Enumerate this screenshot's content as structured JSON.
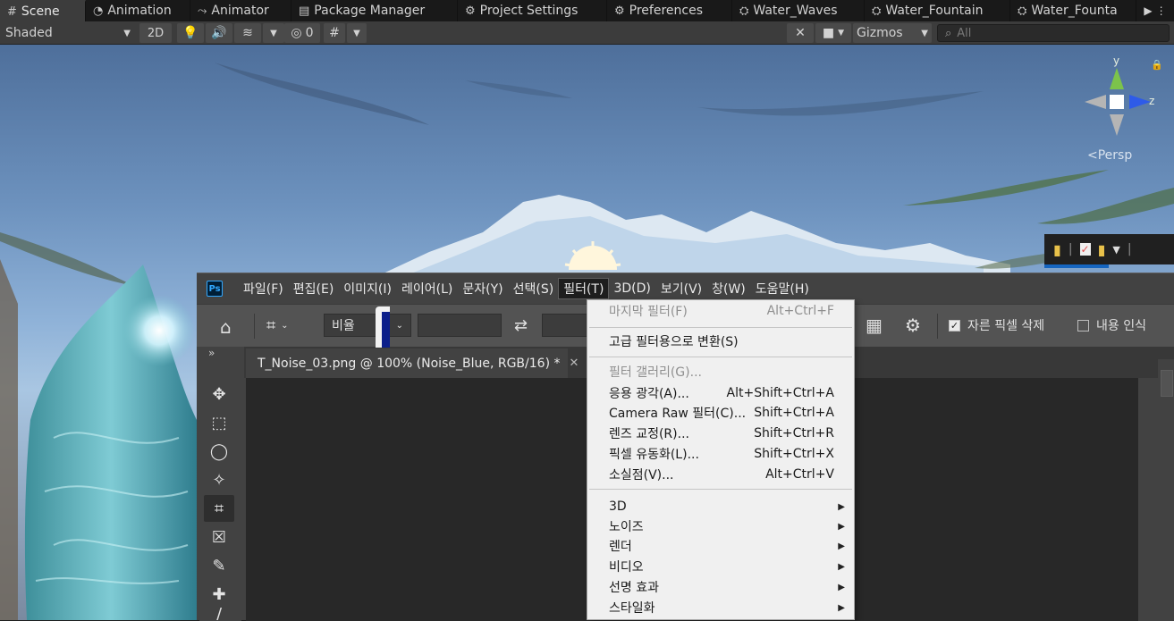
{
  "unity": {
    "tabs": [
      {
        "icon": "#",
        "label": "Scene"
      },
      {
        "icon": "◔",
        "label": "Animation"
      },
      {
        "icon": "⤳",
        "label": "Animator"
      },
      {
        "icon": "▤",
        "label": "Package Manager"
      },
      {
        "icon": "⚙",
        "label": "Project Settings"
      },
      {
        "icon": "⚙",
        "label": "Preferences"
      },
      {
        "icon": "⛭",
        "label": "Water_Waves"
      },
      {
        "icon": "⛭",
        "label": "Water_Fountain"
      },
      {
        "icon": "⛭",
        "label": "Water_Founta"
      }
    ],
    "toolbar": {
      "shading_mode": "Shaded",
      "mode_2d": "2D",
      "hidden_count": "0",
      "gizmos_label": "Gizmos",
      "search_placeholder": "All"
    },
    "scene": {
      "projection_label": "Persp",
      "axis_y": "y",
      "axis_z": "z"
    }
  },
  "photoshop": {
    "logo": "Ps",
    "menus": [
      "파일(F)",
      "편집(E)",
      "이미지(I)",
      "레이어(L)",
      "문자(Y)",
      "선택(S)",
      "필터(T)",
      "3D(D)",
      "보기(V)",
      "창(W)",
      "도움말(H)"
    ],
    "active_menu": "필터(T)",
    "options": {
      "ratio_label": "비율",
      "delete_cropped_label": "자른 픽셀 삭제",
      "delete_cropped_checked": true,
      "content_aware_label": "내용 인식",
      "content_aware_checked": false
    },
    "document_tab": "T_Noise_03.png @ 100% (Noise_Blue, RGB/16) *",
    "filter_menu": {
      "items": [
        {
          "label": "마지막 필터(F)",
          "shortcut": "Alt+Ctrl+F",
          "disabled": true
        },
        {
          "label": "고급 필터용으로 변환(S)",
          "shortcut": ""
        },
        {
          "label": "필터 갤러리(G)...",
          "shortcut": "",
          "disabled": true
        },
        {
          "label": "응용 광각(A)...",
          "shortcut": "Alt+Shift+Ctrl+A"
        },
        {
          "label": "Camera Raw 필터(C)...",
          "shortcut": "Shift+Ctrl+A"
        },
        {
          "label": "렌즈 교정(R)...",
          "shortcut": "Shift+Ctrl+R"
        },
        {
          "label": "픽셀 유동화(L)...",
          "shortcut": "Shift+Ctrl+X"
        },
        {
          "label": "소실점(V)...",
          "shortcut": "Alt+Ctrl+V"
        },
        {
          "label": "3D",
          "submenu": true
        },
        {
          "label": "노이즈",
          "submenu": true
        },
        {
          "label": "렌더",
          "submenu": true
        },
        {
          "label": "비디오",
          "submenu": true
        },
        {
          "label": "선명 효과",
          "submenu": true
        },
        {
          "label": "스타일화",
          "submenu": true
        }
      ]
    }
  }
}
